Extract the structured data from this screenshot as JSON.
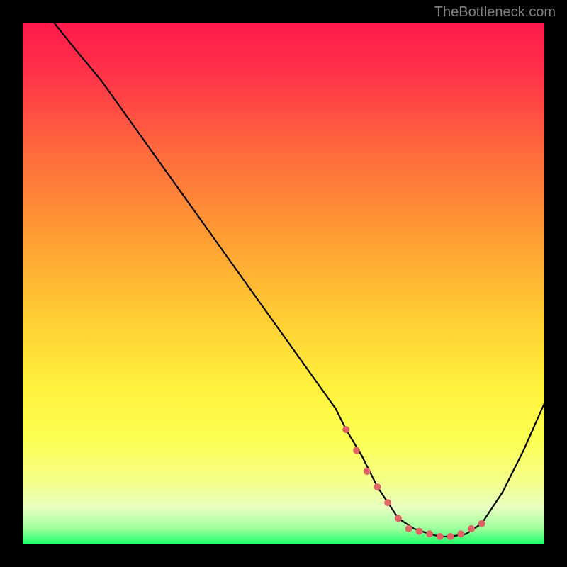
{
  "watermark": "TheBottleneck.com",
  "chart_data": {
    "type": "line",
    "title": "",
    "xlabel": "",
    "ylabel": "",
    "xlim": [
      0,
      100
    ],
    "ylim": [
      0,
      100
    ],
    "series": [
      {
        "name": "curve",
        "color": "#000000",
        "x": [
          6,
          10,
          15,
          20,
          25,
          30,
          35,
          40,
          45,
          50,
          55,
          60,
          62,
          65,
          68,
          70,
          72,
          75,
          78,
          80,
          82,
          85,
          88,
          92,
          96,
          100
        ],
        "values": [
          100,
          95,
          89,
          82,
          75,
          68,
          61,
          54,
          47,
          40,
          33,
          26,
          22,
          17,
          11,
          8,
          5,
          3,
          2,
          1.5,
          1.5,
          2,
          4,
          10,
          18,
          27
        ]
      },
      {
        "name": "highlight-dots",
        "color": "#e06666",
        "style": "dotted-thick",
        "x": [
          62,
          64,
          66,
          68,
          70,
          72,
          74,
          76,
          78,
          80,
          82,
          84,
          86,
          88
        ],
        "values": [
          22,
          18,
          14,
          11,
          8,
          5,
          3,
          2.5,
          2,
          1.5,
          1.5,
          2,
          3,
          4
        ]
      }
    ],
    "gradient_stops": [
      {
        "offset": 0.0,
        "color": "#ff1a4d"
      },
      {
        "offset": 0.1,
        "color": "#ff3348"
      },
      {
        "offset": 0.25,
        "color": "#ff6b3d"
      },
      {
        "offset": 0.4,
        "color": "#ff9933"
      },
      {
        "offset": 0.55,
        "color": "#ffc933"
      },
      {
        "offset": 0.7,
        "color": "#fff23d"
      },
      {
        "offset": 0.8,
        "color": "#fcff52"
      },
      {
        "offset": 0.88,
        "color": "#f5ff8a"
      },
      {
        "offset": 0.93,
        "color": "#e8ffc2"
      },
      {
        "offset": 0.97,
        "color": "#9cff9c"
      },
      {
        "offset": 1.0,
        "color": "#1aff66"
      }
    ]
  }
}
